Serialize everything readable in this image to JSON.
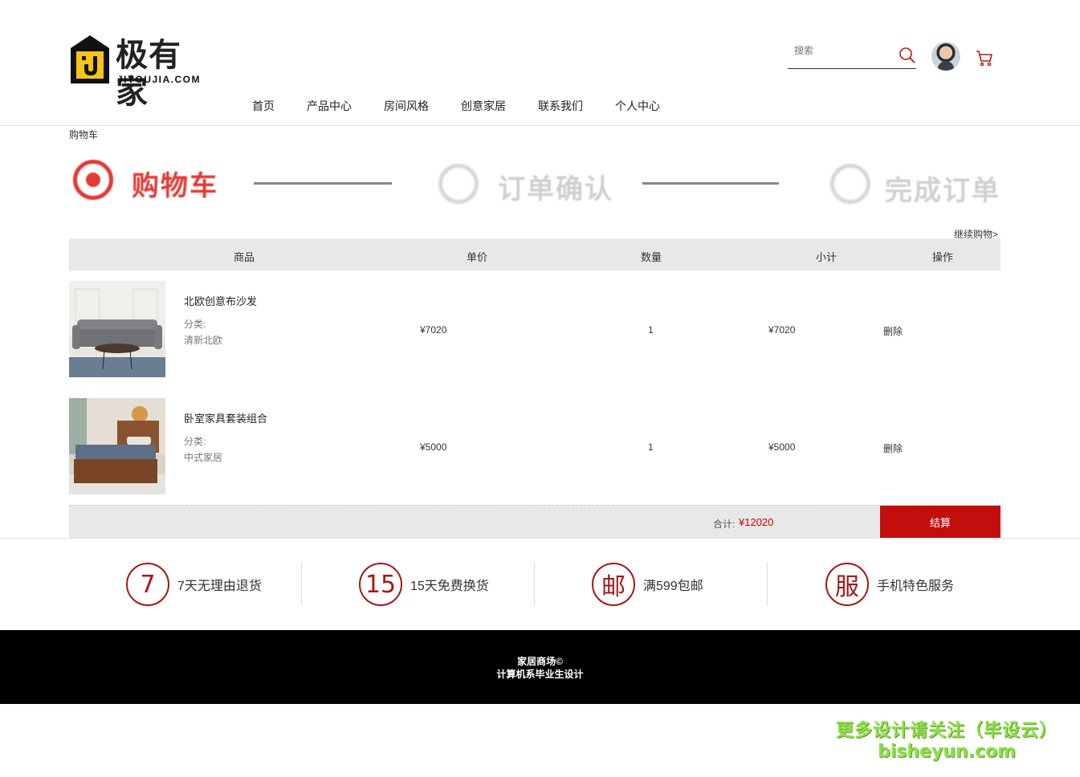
{
  "header": {
    "logo_text": "极有家",
    "logo_sub": "JIYOUJIA.COM",
    "search_placeholder": "搜索",
    "nav": [
      "首页",
      "产品中心",
      "房间风格",
      "创意家居",
      "联系我们",
      "个人中心"
    ]
  },
  "breadcrumb": "购物车",
  "steps": [
    {
      "label": "购物车",
      "active": true
    },
    {
      "label": "订单确认",
      "active": false
    },
    {
      "label": "完成订单",
      "active": false
    }
  ],
  "continue_shopping": "继续购物>",
  "table": {
    "headers": [
      "商品",
      "单价",
      "数量",
      "小计",
      "操作"
    ],
    "rows": [
      {
        "name": "北欧创意布沙发",
        "category_label": "分类:",
        "category": "清新北欧",
        "price": "¥7020",
        "qty": "1",
        "subtotal": "¥7020",
        "action": "删除"
      },
      {
        "name": "卧室家具套装组合",
        "category_label": "分类:",
        "category": "中式家居",
        "price": "¥5000",
        "qty": "1",
        "subtotal": "¥5000",
        "action": "删除"
      }
    ],
    "total_label": "合计:",
    "total_value": "¥12020",
    "checkout_label": "结算"
  },
  "services": [
    {
      "icon_text": "7",
      "label": "7天无理由退货"
    },
    {
      "icon_text": "15",
      "label": "15天免费换货"
    },
    {
      "icon_text": "邮",
      "label": "满599包邮"
    },
    {
      "icon_text": "服",
      "label": "手机特色服务"
    }
  ],
  "footer": {
    "line1": "家居商场©",
    "line2": "计算机系毕业生设计"
  },
  "watermark": {
    "line1": "更多设计请关注（毕设云）",
    "line2": "bisheyun.com"
  },
  "colors": {
    "accent": "#c40d0d",
    "step_active": "#e53935",
    "step_inactive": "#d6d6d6",
    "footer_bg": "#000000"
  }
}
